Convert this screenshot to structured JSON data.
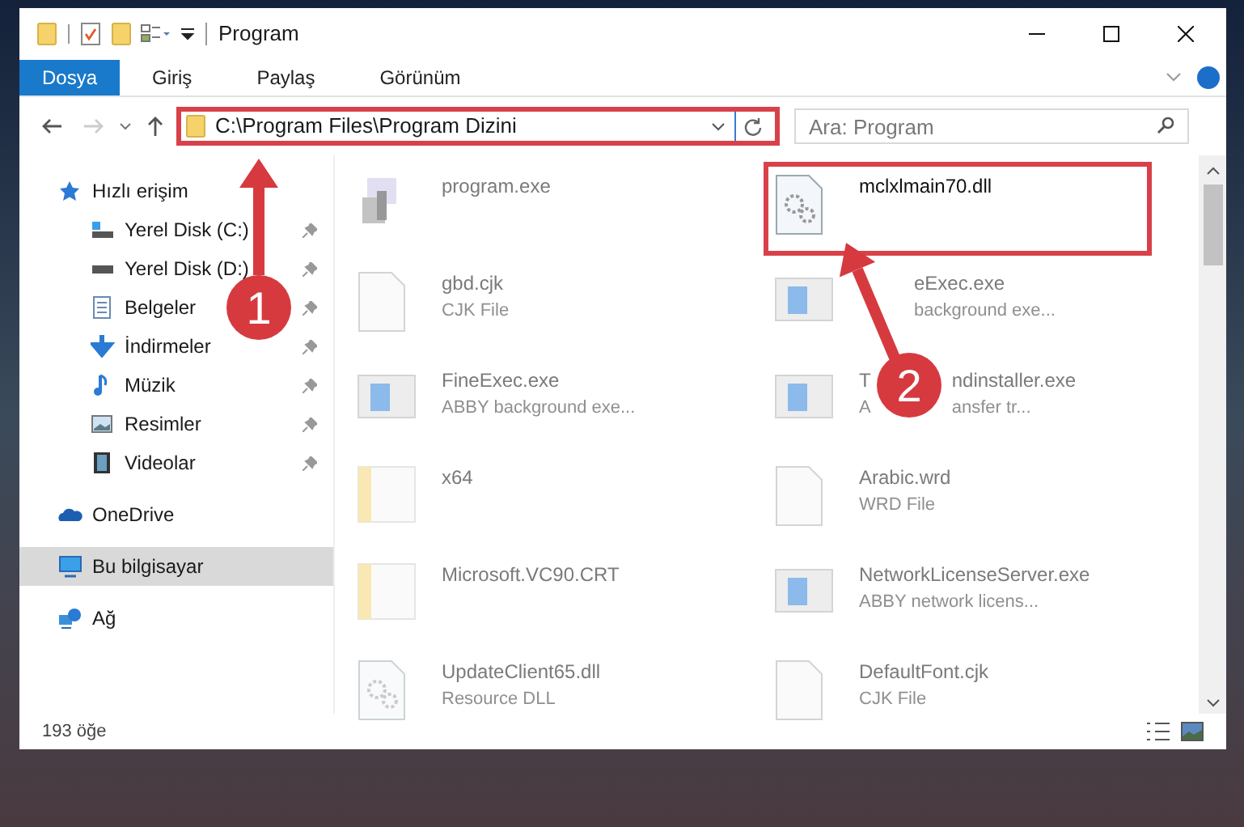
{
  "window": {
    "title": "Program"
  },
  "ribbon_tabs": [
    {
      "label": "Dosya",
      "selected": true
    },
    {
      "label": "Giriş",
      "selected": false
    },
    {
      "label": "Paylaş",
      "selected": false
    },
    {
      "label": "Görünüm",
      "selected": false
    }
  ],
  "address": {
    "value": "C:\\Program Files\\Program Dizini"
  },
  "search": {
    "placeholder": "Ara: Program"
  },
  "sidebar": {
    "items": [
      {
        "label": "Hızlı erişim",
        "kind": "star",
        "pinned": false,
        "selected": false,
        "children": [
          {
            "label": "Yerel Disk (C:)",
            "kind": "drivec",
            "pinned": true,
            "selected": false
          },
          {
            "label": "Yerel Disk (D:)",
            "kind": "drive",
            "pinned": true,
            "selected": false
          },
          {
            "label": "Belgeler",
            "kind": "docs",
            "pinned": true,
            "selected": false
          },
          {
            "label": "İndirmeler",
            "kind": "down",
            "pinned": true,
            "selected": false
          },
          {
            "label": "Müzik",
            "kind": "music",
            "pinned": true,
            "selected": false
          },
          {
            "label": "Resimler",
            "kind": "pics",
            "pinned": true,
            "selected": false
          },
          {
            "label": "Videolar",
            "kind": "video",
            "pinned": true,
            "selected": false
          }
        ]
      },
      {
        "label": "OneDrive",
        "kind": "cloud",
        "pinned": false,
        "selected": false
      },
      {
        "label": "Bu bilgisayar",
        "kind": "pc",
        "pinned": false,
        "selected": true
      },
      {
        "label": "Ağ",
        "kind": "net",
        "pinned": false,
        "selected": false
      }
    ]
  },
  "files": [
    {
      "name": "program.exe",
      "kind": "setup",
      "faded": true,
      "highlighted": false
    },
    {
      "name": "mclxlmain70.dll",
      "kind": "dll",
      "faded": false,
      "highlighted": true
    },
    {
      "name": "gbd.cjk",
      "type": "CJK File",
      "kind": "file",
      "faded": true,
      "highlighted": false
    },
    {
      "name": "eExec.exe",
      "type": "background exe...",
      "kind": "app",
      "faded": true,
      "highlighted": false,
      "covered": true
    },
    {
      "name": "FineExec.exe",
      "type": "ABBY background exe...",
      "kind": "app",
      "faded": true,
      "highlighted": false
    },
    {
      "name": "T",
      "name_end": "ndinstaller.exe",
      "type": "A",
      "type_end": "ansfer tr...",
      "kind": "app",
      "faded": true,
      "highlighted": false
    },
    {
      "name": "x64",
      "kind": "folder",
      "faded": true,
      "highlighted": false
    },
    {
      "name": "Arabic.wrd",
      "type": "WRD File",
      "kind": "file",
      "faded": true,
      "highlighted": false
    },
    {
      "name": "Microsoft.VC90.CRT",
      "kind": "folder",
      "faded": true,
      "highlighted": false
    },
    {
      "name": "NetworkLicenseServer.exe",
      "type": "ABBY network licens...",
      "kind": "app",
      "faded": true,
      "highlighted": false
    },
    {
      "name": "UpdateClient65.dll",
      "type": "Resource DLL",
      "kind": "dll",
      "faded": true,
      "highlighted": false
    },
    {
      "name": "DefaultFont.cjk",
      "type": "CJK File",
      "kind": "file",
      "faded": true,
      "highlighted": false
    }
  ],
  "status_bar": {
    "count": "193 öğe"
  },
  "annotations": [
    {
      "label": "1"
    },
    {
      "label": "2"
    }
  ]
}
